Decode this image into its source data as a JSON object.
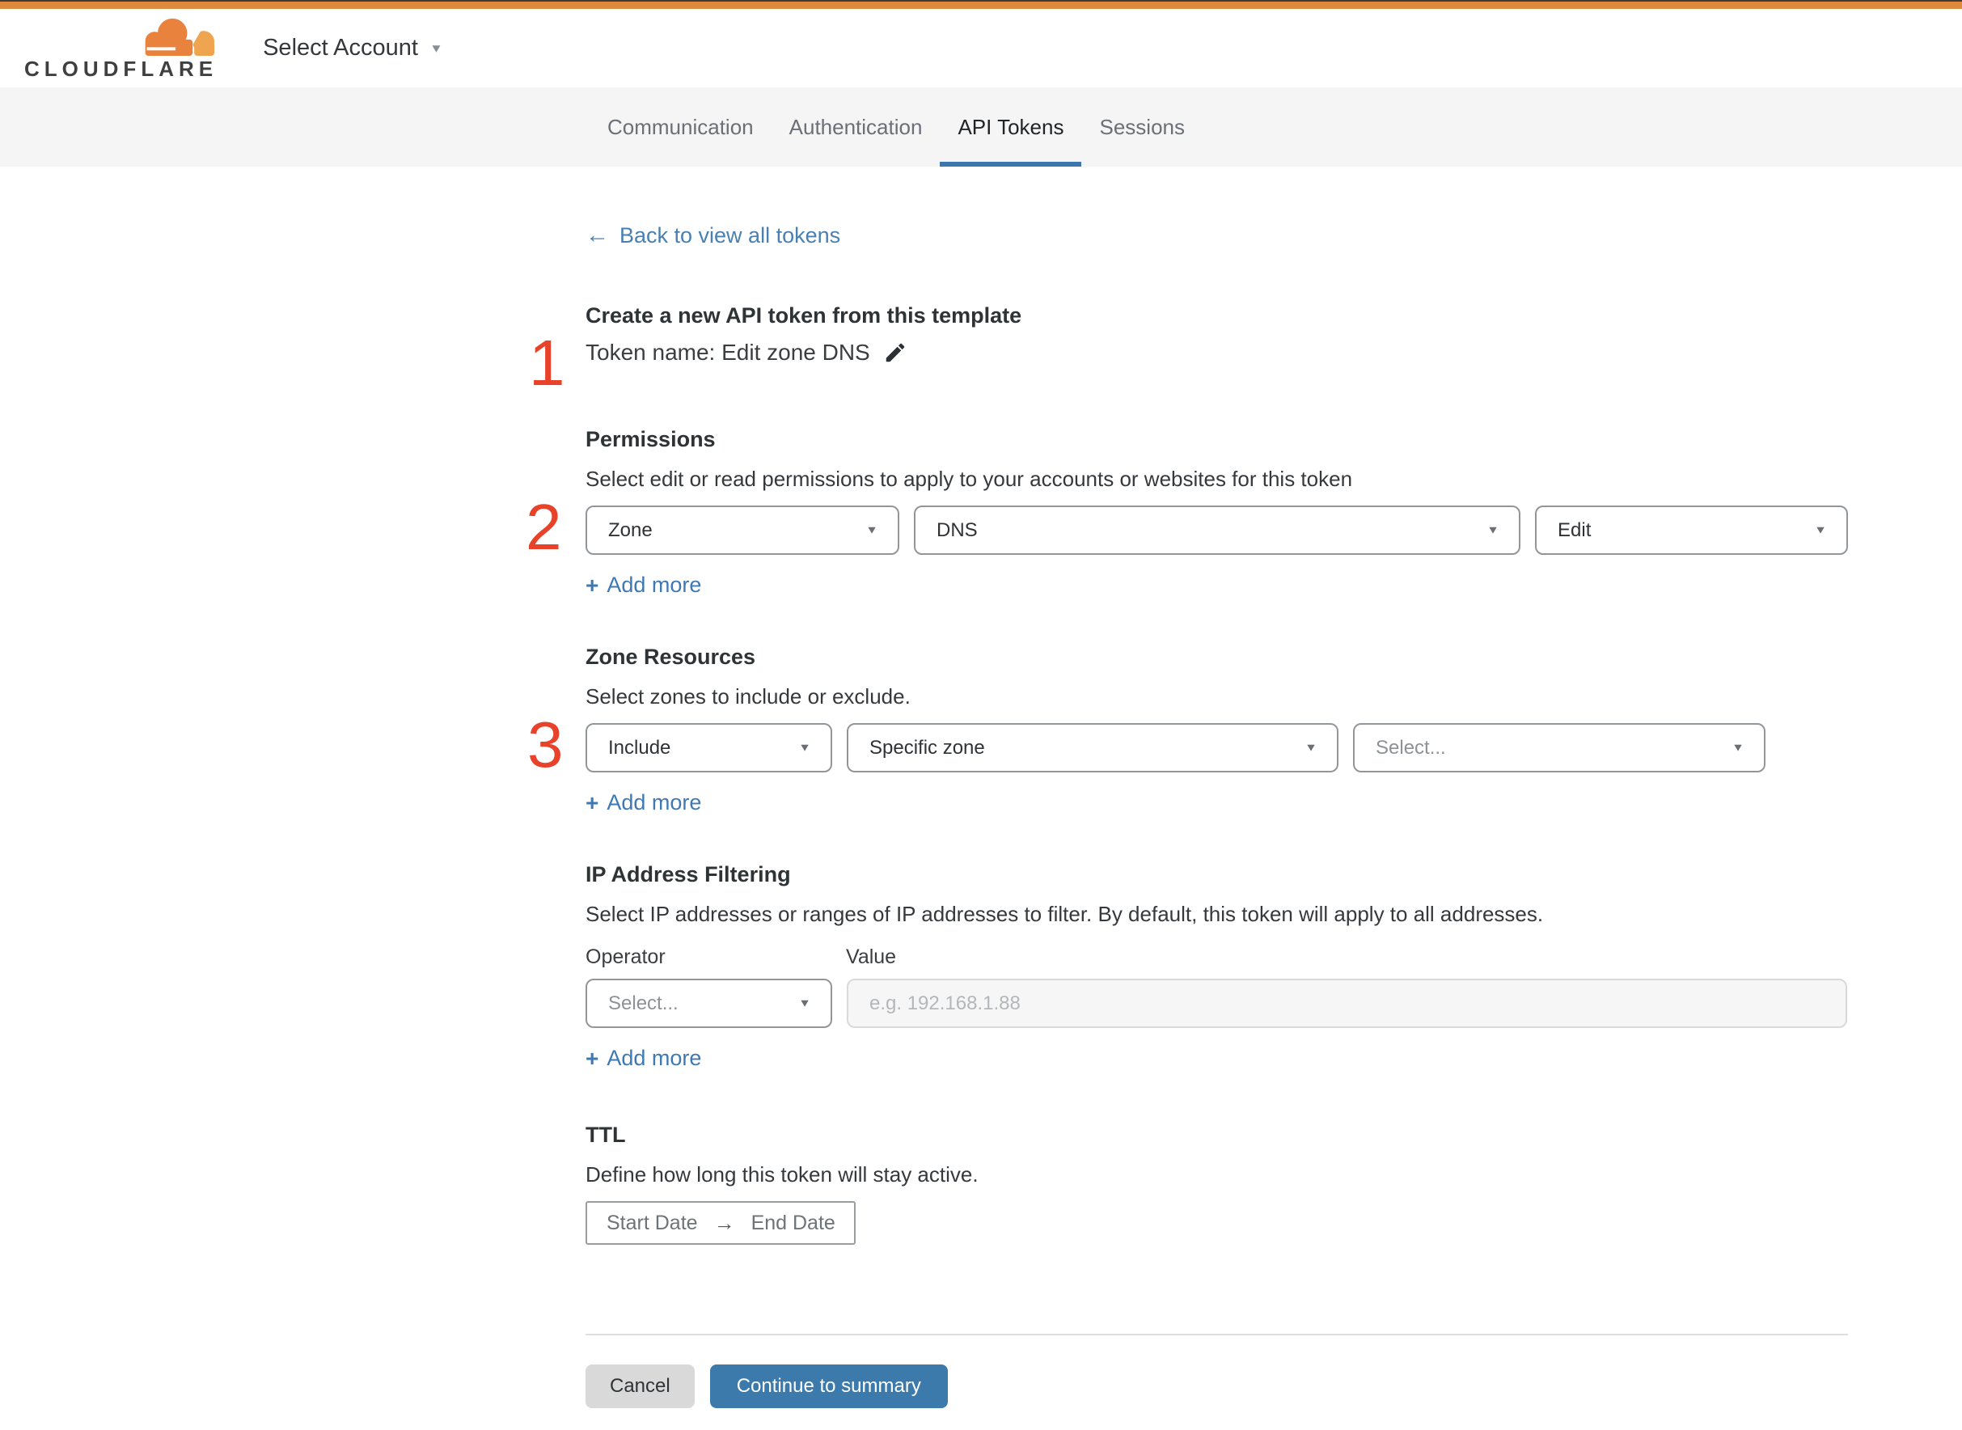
{
  "colors": {
    "orange_bar": "#de8a3e",
    "brand_dark": "#404041",
    "marker_red": "#e8432a",
    "link_blue": "#4a80b1",
    "add_blue": "#3e79b4",
    "button_blue": "#3d7aac",
    "tab_underline": "#3c76ab",
    "tabbar_bg": "#f5f5f6",
    "cancel_bg": "#d9d9d9"
  },
  "icons": {
    "back_arrow": "←",
    "plus": "+",
    "caret_down": "▼",
    "range_arrow": "→"
  },
  "header": {
    "logo_text": "CLOUDFLARE",
    "account_selector_label": "Select Account"
  },
  "tabs": {
    "items": [
      {
        "label": "Communication",
        "active": false
      },
      {
        "label": "Authentication",
        "active": false
      },
      {
        "label": "API Tokens",
        "active": true
      },
      {
        "label": "Sessions",
        "active": false
      }
    ]
  },
  "back_link": {
    "label": "Back to view all tokens"
  },
  "token_template": {
    "marker": "1",
    "heading": "Create a new API token from this template",
    "token_name_line": "Token name: Edit zone DNS"
  },
  "permissions": {
    "marker": "2",
    "heading": "Permissions",
    "description": "Select edit or read permissions to apply to your accounts or websites for this token",
    "selects": [
      {
        "value": "Zone"
      },
      {
        "value": "DNS"
      },
      {
        "value": "Edit"
      }
    ],
    "add_more_label": "Add more"
  },
  "zone_resources": {
    "marker": "3",
    "heading": "Zone Resources",
    "description": "Select zones to include or exclude.",
    "selects": [
      {
        "value": "Include"
      },
      {
        "value": "Specific zone"
      },
      {
        "value": "Select..."
      }
    ],
    "add_more_label": "Add more"
  },
  "ip_filtering": {
    "heading": "IP Address Filtering",
    "description": "Select IP addresses or ranges of IP addresses to filter. By default, this token will apply to all addresses.",
    "operator_label": "Operator",
    "value_label": "Value",
    "operator_select_value": "Select...",
    "value_placeholder": "e.g. 192.168.1.88",
    "add_more_label": "Add more"
  },
  "ttl": {
    "heading": "TTL",
    "description": "Define how long this token will stay active.",
    "start_date_placeholder": "Start Date",
    "end_date_placeholder": "End Date"
  },
  "footer": {
    "cancel_label": "Cancel",
    "continue_label": "Continue to summary"
  }
}
